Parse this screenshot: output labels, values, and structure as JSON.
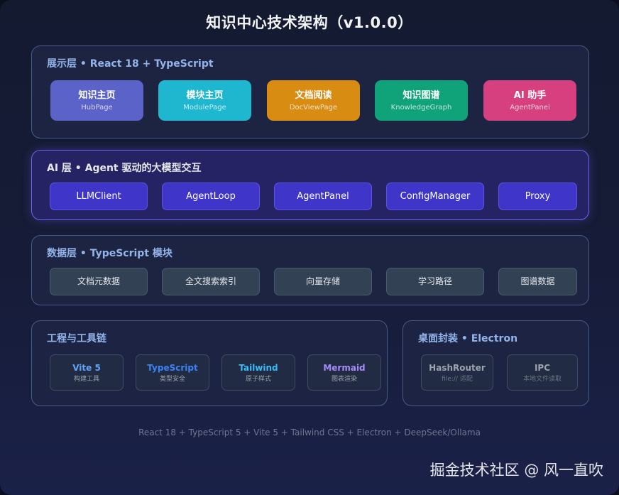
{
  "title": "知识中心技术架构（v1.0.0）",
  "presentation": {
    "heading": "展示层 • React 18 + TypeScript",
    "cards": [
      {
        "title": "知识主页",
        "sub": "HubPage",
        "color": "#5b63c9"
      },
      {
        "title": "模块主页",
        "sub": "ModulePage",
        "color": "#1fb6d0"
      },
      {
        "title": "文档阅读",
        "sub": "DocViewPage",
        "color": "#d98c12"
      },
      {
        "title": "知识图谱",
        "sub": "KnowledgeGraph",
        "color": "#10a37a"
      },
      {
        "title": "AI 助手",
        "sub": "AgentPanel",
        "color": "#d6407f"
      }
    ]
  },
  "ai_layer": {
    "heading": "AI 层 • Agent 驱动的大模型交互",
    "items": [
      "LLMClient",
      "AgentLoop",
      "AgentPanel",
      "ConfigManager",
      "Proxy"
    ]
  },
  "data_layer": {
    "heading": "数据层 • TypeScript 模块",
    "items": [
      "文档元数据",
      "全文搜索索引",
      "向量存储",
      "学习路径",
      "图谱数据"
    ]
  },
  "tooling": {
    "heading": "工程与工具链",
    "items": [
      {
        "title": "Vite 5",
        "sub": "构建工具",
        "color": "#60a5fa"
      },
      {
        "title": "TypeScript",
        "sub": "类型安全",
        "color": "#3b82f6"
      },
      {
        "title": "Tailwind",
        "sub": "原子样式",
        "color": "#38bdf8"
      },
      {
        "title": "Mermaid",
        "sub": "图表渲染",
        "color": "#a78bfa"
      }
    ]
  },
  "desktop": {
    "heading": "桌面封装 • Electron",
    "items": [
      {
        "title": "HashRouter",
        "sub": "file:// 适配",
        "color": "#9ca3af"
      },
      {
        "title": "IPC",
        "sub": "本地文件读取",
        "color": "#9ca3af"
      }
    ]
  },
  "footer": "React 18 + TypeScript 5 + Vite 5 + Tailwind CSS + Electron + DeepSeek/Ollama",
  "watermark": "掘金技术社区 @ 风一直吹"
}
